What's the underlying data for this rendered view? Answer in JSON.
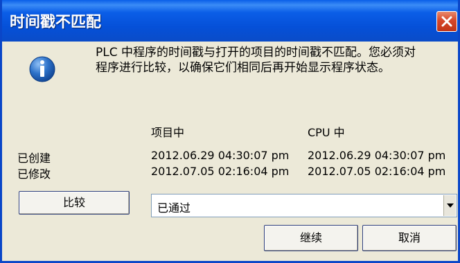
{
  "dialog": {
    "title": "时间戳不匹配",
    "message": "PLC 中程序的时间戳与打开的项目的时间戳不匹配。您必须对\n程序进行比较，以确保它们相同后再开始显示程序状态。"
  },
  "table": {
    "columns": [
      "项目中",
      "CPU 中"
    ],
    "rows": [
      {
        "label": "已创建",
        "project": "2012.06.29  04:30:07 pm",
        "cpu": "2012.06.29  04:30:07 pm"
      },
      {
        "label": "已修改",
        "project": "2012.07.05  02:16:04 pm",
        "cpu": "2012.07.05  02:16:04 pm"
      }
    ]
  },
  "compare_button": "比较",
  "result_select": {
    "value": "已通过"
  },
  "buttons": {
    "continue": "继续",
    "cancel": "取消"
  },
  "icons": {
    "title_close": "close-icon",
    "info": "info-icon",
    "dropdown": "chevron-down-icon"
  },
  "colors": {
    "titlebar": "#0a5fe8",
    "window_bg": "#ece9d8",
    "close_button": "#d6472a",
    "info_icon": "#1f5fb3"
  }
}
